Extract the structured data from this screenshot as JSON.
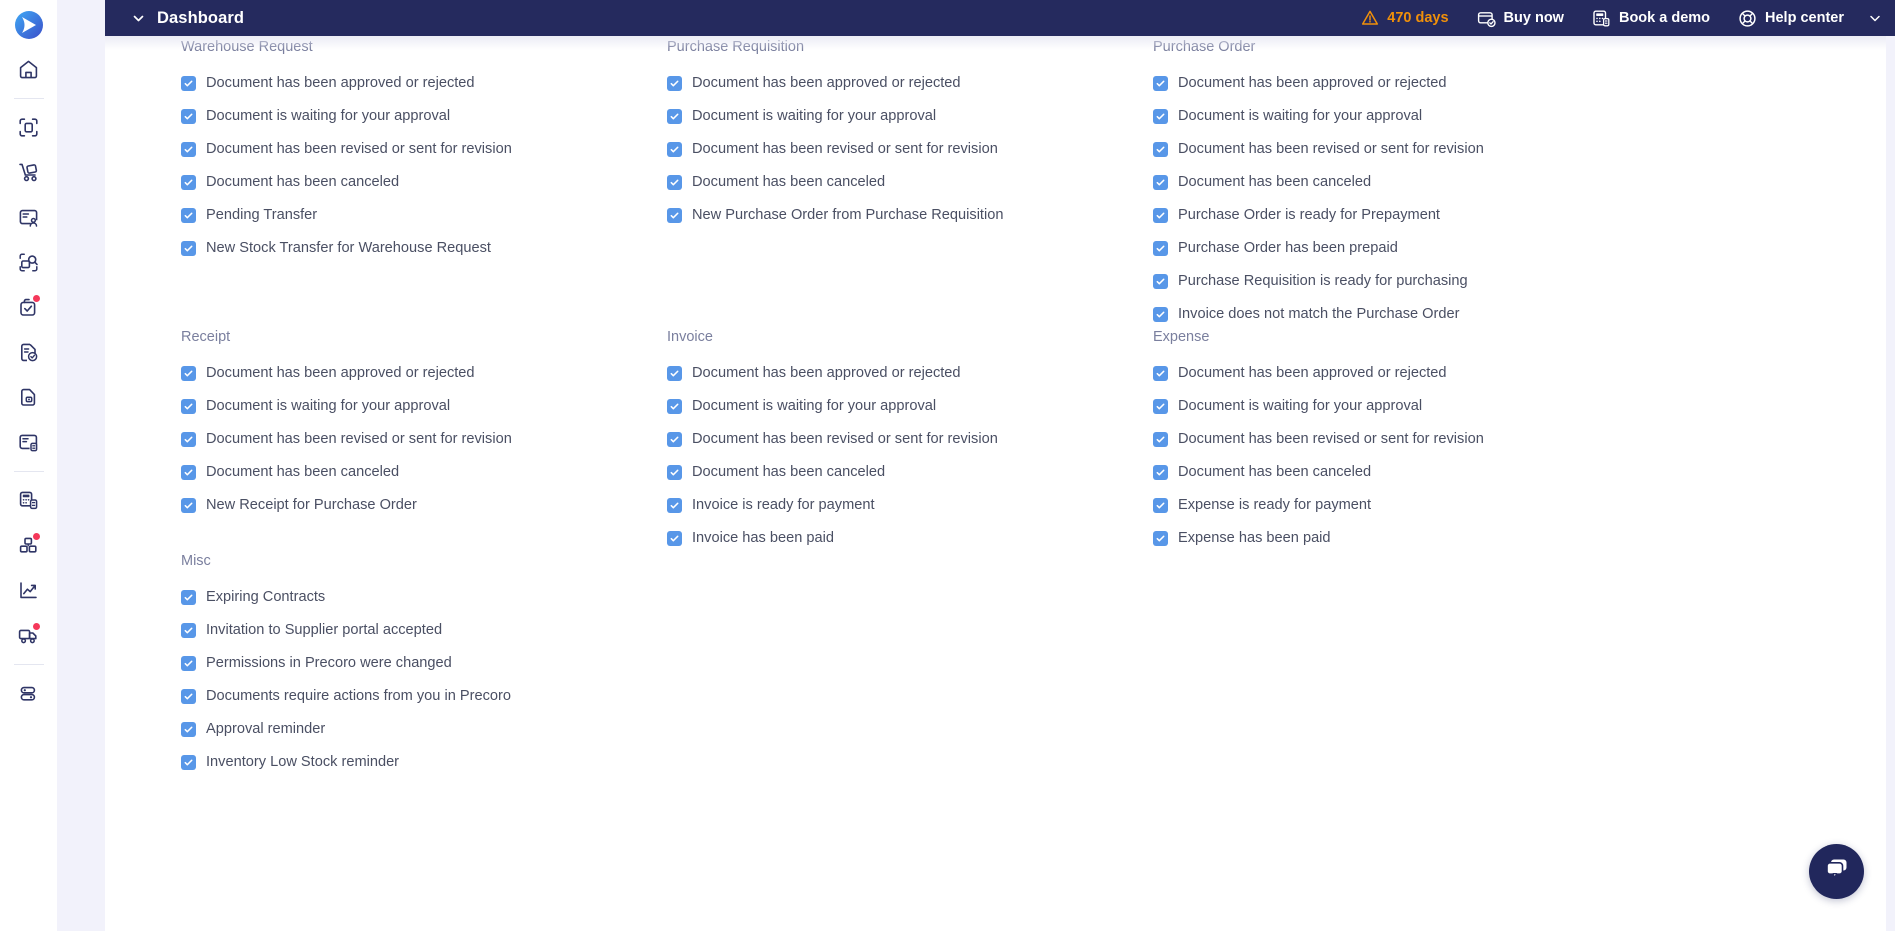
{
  "app": {
    "logo_name": "precoro-logo"
  },
  "topbar": {
    "chevron_icon": "chevron-down-icon",
    "title": "Dashboard",
    "trial": {
      "icon": "warning-triangle-icon",
      "label": "470 days"
    },
    "buy_now": {
      "icon": "card-check-icon",
      "label": "Buy now"
    },
    "book_demo": {
      "icon": "calculator-icon",
      "label": "Book a demo"
    },
    "help_center": {
      "icon": "lifebuoy-icon",
      "label": "Help center"
    },
    "caret_icon": "chevron-down-icon",
    "avatar_icon": "user-icon",
    "accent_warn_color": "#f0900a",
    "background_color": "#252a5e"
  },
  "sidebar": {
    "items": [
      {
        "name": "home",
        "icon": "home-icon",
        "badge": false
      },
      {
        "name": "scan-document",
        "icon": "document-scan-icon",
        "badge": false
      },
      {
        "name": "warehouse-request",
        "icon": "hand-truck-icon",
        "badge": false
      },
      {
        "name": "supplier-contact",
        "icon": "contact-card-icon",
        "badge": false
      },
      {
        "name": "rfq-search",
        "icon": "document-search-icon",
        "badge": false
      },
      {
        "name": "approvals",
        "icon": "checkbox-approve-icon",
        "badge": true
      },
      {
        "name": "purchase-order",
        "icon": "document-check-icon",
        "badge": false
      },
      {
        "name": "receipt",
        "icon": "document-lock-icon",
        "badge": false
      },
      {
        "name": "invoice",
        "icon": "card-invoice-icon",
        "badge": false
      },
      {
        "name": "budgets",
        "icon": "calculator-doc-icon",
        "badge": false
      },
      {
        "name": "inventory",
        "icon": "boxes-icon",
        "badge": true
      },
      {
        "name": "reports",
        "icon": "trend-chart-icon",
        "badge": false
      },
      {
        "name": "deliveries",
        "icon": "truck-icon",
        "badge": true
      },
      {
        "name": "settings-toggles",
        "icon": "toggles-icon",
        "badge": false
      }
    ]
  },
  "checkbox_color": "#5897e8",
  "main": {
    "groups": [
      {
        "id": "warehouse-request",
        "title": "Warehouse Request",
        "column": 1,
        "options": [
          {
            "label": "Document has been approved or rejected",
            "checked": true
          },
          {
            "label": "Document is waiting for your approval",
            "checked": true
          },
          {
            "label": "Document has been revised or sent for revision",
            "checked": true
          },
          {
            "label": "Document has been canceled",
            "checked": true
          },
          {
            "label": "Pending Transfer",
            "checked": true
          },
          {
            "label": "New Stock Transfer for Warehouse Request",
            "checked": true
          }
        ]
      },
      {
        "id": "purchase-requisition",
        "title": "Purchase Requisition",
        "column": 2,
        "options": [
          {
            "label": "Document has been approved or rejected",
            "checked": true
          },
          {
            "label": "Document is waiting for your approval",
            "checked": true
          },
          {
            "label": "Document has been revised or sent for revision",
            "checked": true
          },
          {
            "label": "Document has been canceled",
            "checked": true
          },
          {
            "label": "New Purchase Order from Purchase Requisition",
            "checked": true
          }
        ]
      },
      {
        "id": "purchase-order",
        "title": "Purchase Order",
        "column": 3,
        "options": [
          {
            "label": "Document has been approved or rejected",
            "checked": true
          },
          {
            "label": "Document is waiting for your approval",
            "checked": true
          },
          {
            "label": "Document has been revised or sent for revision",
            "checked": true
          },
          {
            "label": "Document has been canceled",
            "checked": true
          },
          {
            "label": "Purchase Order is ready for Prepayment",
            "checked": true
          },
          {
            "label": "Purchase Order has been prepaid",
            "checked": true
          },
          {
            "label": "Purchase Requisition is ready for purchasing",
            "checked": true
          },
          {
            "label": "Invoice does not match the Purchase Order",
            "checked": true
          }
        ]
      },
      {
        "id": "receipt",
        "title": "Receipt",
        "column": 1,
        "options": [
          {
            "label": "Document has been approved or rejected",
            "checked": true
          },
          {
            "label": "Document is waiting for your approval",
            "checked": true
          },
          {
            "label": "Document has been revised or sent for revision",
            "checked": true
          },
          {
            "label": "Document has been canceled",
            "checked": true
          },
          {
            "label": "New Receipt for Purchase Order",
            "checked": true
          }
        ]
      },
      {
        "id": "invoice",
        "title": "Invoice",
        "column": 2,
        "options": [
          {
            "label": "Document has been approved or rejected",
            "checked": true
          },
          {
            "label": "Document is waiting for your approval",
            "checked": true
          },
          {
            "label": "Document has been revised or sent for revision",
            "checked": true
          },
          {
            "label": "Document has been canceled",
            "checked": true
          },
          {
            "label": "Invoice is ready for payment",
            "checked": true
          },
          {
            "label": "Invoice has been paid",
            "checked": true
          }
        ]
      },
      {
        "id": "expense",
        "title": "Expense",
        "column": 3,
        "options": [
          {
            "label": "Document has been approved or rejected",
            "checked": true
          },
          {
            "label": "Document is waiting for your approval",
            "checked": true
          },
          {
            "label": "Document has been revised or sent for revision",
            "checked": true
          },
          {
            "label": "Document has been canceled",
            "checked": true
          },
          {
            "label": "Expense is ready for payment",
            "checked": true
          },
          {
            "label": "Expense has been paid",
            "checked": true
          }
        ]
      },
      {
        "id": "misc",
        "title": "Misc",
        "column": 1,
        "options": [
          {
            "label": "Expiring Contracts",
            "checked": true
          },
          {
            "label": "Invitation to Supplier portal accepted",
            "checked": true
          },
          {
            "label": "Permissions in Precoro were changed",
            "checked": true
          },
          {
            "label": "Documents require actions from you in Precoro",
            "checked": true
          },
          {
            "label": "Approval reminder",
            "checked": true
          },
          {
            "label": "Inventory Low Stock reminder",
            "checked": true
          }
        ]
      }
    ]
  },
  "chat": {
    "icon": "chat-bubbles-icon",
    "color": "#21275c"
  }
}
